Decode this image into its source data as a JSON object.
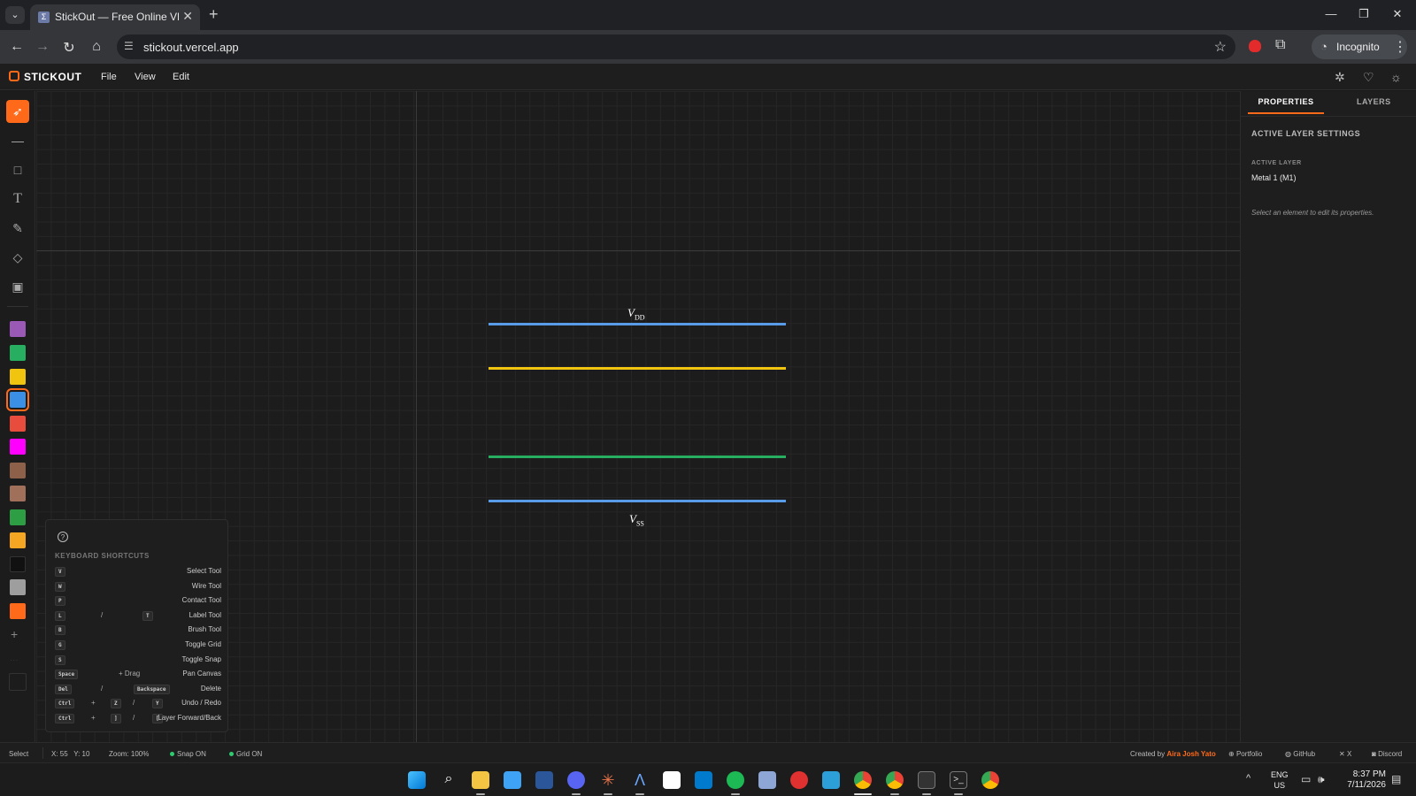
{
  "browser": {
    "tab_title": "StickOut — Free Online VLSI Sti",
    "url": "stickout.vercel.app",
    "incognito_label": "Incognito"
  },
  "app": {
    "brand": "STICKOUT",
    "menu": [
      "File",
      "View",
      "Edit"
    ]
  },
  "colors": {
    "accent": "#ff6a1a",
    "palette": [
      "#9b59b6",
      "#27ae60",
      "#f1c40f",
      "#3b8fe5",
      "#e74c3c",
      "#ff00ff",
      "#8d6149",
      "#a0705a",
      "#2e9e44",
      "#f5a623",
      "#111111",
      "#9e9e9e",
      "#ff6a1a"
    ],
    "selected_swatch_index": 3,
    "rail_vdd": "#5a9be8",
    "rail_yellow": "#f1c40f",
    "rail_green": "#27ae60",
    "rail_vss": "#5a9be8"
  },
  "canvas": {
    "vdd_label": "V",
    "vdd_sub": "DD",
    "vss_label": "V",
    "vss_sub": "SS"
  },
  "shortcuts": {
    "title": "KEYBOARD SHORTCUTS",
    "rows": [
      {
        "k1": "V",
        "desc": "Select Tool"
      },
      {
        "k1": "W",
        "desc": "Wire Tool"
      },
      {
        "k1": "P",
        "desc": "Contact Tool"
      },
      {
        "k1": "L",
        "sep": "/",
        "k2": "T",
        "desc": "Label Tool"
      },
      {
        "k1": "B",
        "desc": "Brush Tool"
      },
      {
        "k1": "G",
        "desc": "Toggle Grid"
      },
      {
        "k1": "S",
        "desc": "Toggle Snap"
      },
      {
        "k1": "Space",
        "sep": "+ Drag",
        "desc": "Pan Canvas"
      },
      {
        "k1": "Del",
        "sep": "/",
        "k2": "Backspace",
        "desc": "Delete"
      },
      {
        "k1": "Ctrl",
        "plus": "+",
        "k2": "Z",
        "sep2": "/",
        "k3": "Y",
        "desc": "Undo / Redo"
      },
      {
        "k1": "Ctrl",
        "plus": "+",
        "k2": "]",
        "sep2": "/",
        "k3": "[",
        "desc": "Layer Forward/Back"
      }
    ]
  },
  "properties": {
    "tab_properties": "PROPERTIES",
    "tab_layers": "LAYERS",
    "heading": "ACTIVE LAYER SETTINGS",
    "active_layer_label": "ACTIVE LAYER",
    "active_layer_value": "Metal 1 (M1)",
    "hint": "Select an element to edit its properties."
  },
  "status": {
    "tool": "Select",
    "coords": "X: 55   Y: 10",
    "zoom": "Zoom: 100%",
    "snap": "Snap ON",
    "grid": "Grid ON",
    "credit_prefix": "Created by",
    "credit_name": "Aira Josh Yato",
    "portfolio": "Portfolio",
    "github": "GitHub",
    "x": "X",
    "discord": "Discord"
  },
  "taskbar": {
    "lang_top": "ENG",
    "lang_bottom": "US",
    "time": "8:37 PM",
    "date": "7/11/2026"
  }
}
